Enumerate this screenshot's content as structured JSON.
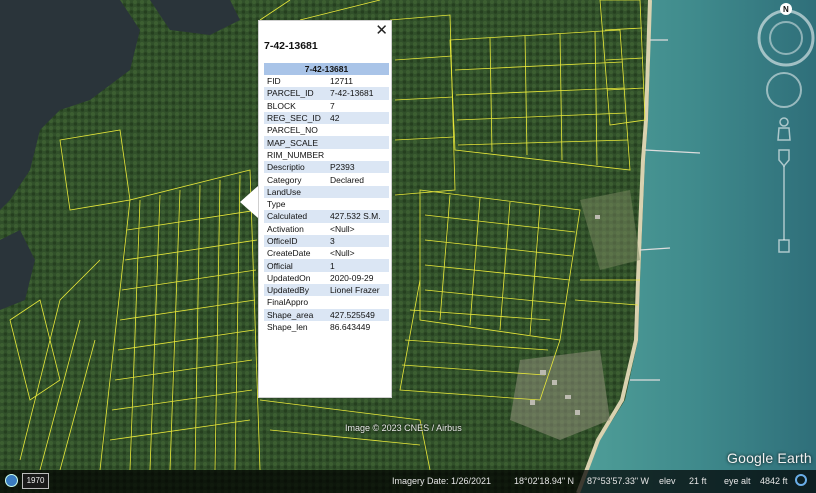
{
  "popup": {
    "title": "7-42-13681",
    "table_header": "7-42-13681",
    "close_glyph": "✕",
    "rows": [
      {
        "key": "FID",
        "value": "12711"
      },
      {
        "key": "PARCEL_ID",
        "value": "7-42-13681"
      },
      {
        "key": "BLOCK",
        "value": "7"
      },
      {
        "key": "REG_SEC_ID",
        "value": "42"
      },
      {
        "key": "PARCEL_NO",
        "value": ""
      },
      {
        "key": "MAP_SCALE",
        "value": ""
      },
      {
        "key": "RIM_NUMBER",
        "value": ""
      },
      {
        "key": "Descriptio",
        "value": "P2393"
      },
      {
        "key": "Category",
        "value": "Declared"
      },
      {
        "key": "LandUse",
        "value": ""
      },
      {
        "key": "Type",
        "value": ""
      },
      {
        "key": "Calculated",
        "value": "427.532 S.M."
      },
      {
        "key": "Activation",
        "value": "<Null>"
      },
      {
        "key": "OfficeID",
        "value": "3"
      },
      {
        "key": "CreateDate",
        "value": "<Null>"
      },
      {
        "key": "Official",
        "value": "1"
      },
      {
        "key": "UpdatedOn",
        "value": "2020-09-29"
      },
      {
        "key": "UpdatedBy",
        "value": "Lionel Frazer"
      },
      {
        "key": "FinalAppro",
        "value": ""
      },
      {
        "key": "Shape_area",
        "value": "427.525549"
      },
      {
        "key": "Shape_len",
        "value": "86.643449"
      }
    ]
  },
  "imagery": {
    "copyright": "Image © 2023 CNES / Airbus",
    "logo": "Google Earth"
  },
  "statusbar": {
    "year": "1970",
    "imagery_date": "Imagery Date: 1/26/2021",
    "lat": "18°02'18.94\" N",
    "lon": "87°53'57.33\" W",
    "elev_label": "elev",
    "elev_value": "21 ft",
    "eye_alt_label": "eye alt",
    "eye_alt_value": "4842 ft"
  },
  "nav": {
    "north": "N"
  },
  "colors": {
    "parcel_lines": "#e8e83a",
    "forest": "#2f4a25",
    "water": "#3f8a8c",
    "lagoon": "#283238",
    "header_blue": "#a9c4e8",
    "row_alt_blue": "#dbe6f4"
  }
}
